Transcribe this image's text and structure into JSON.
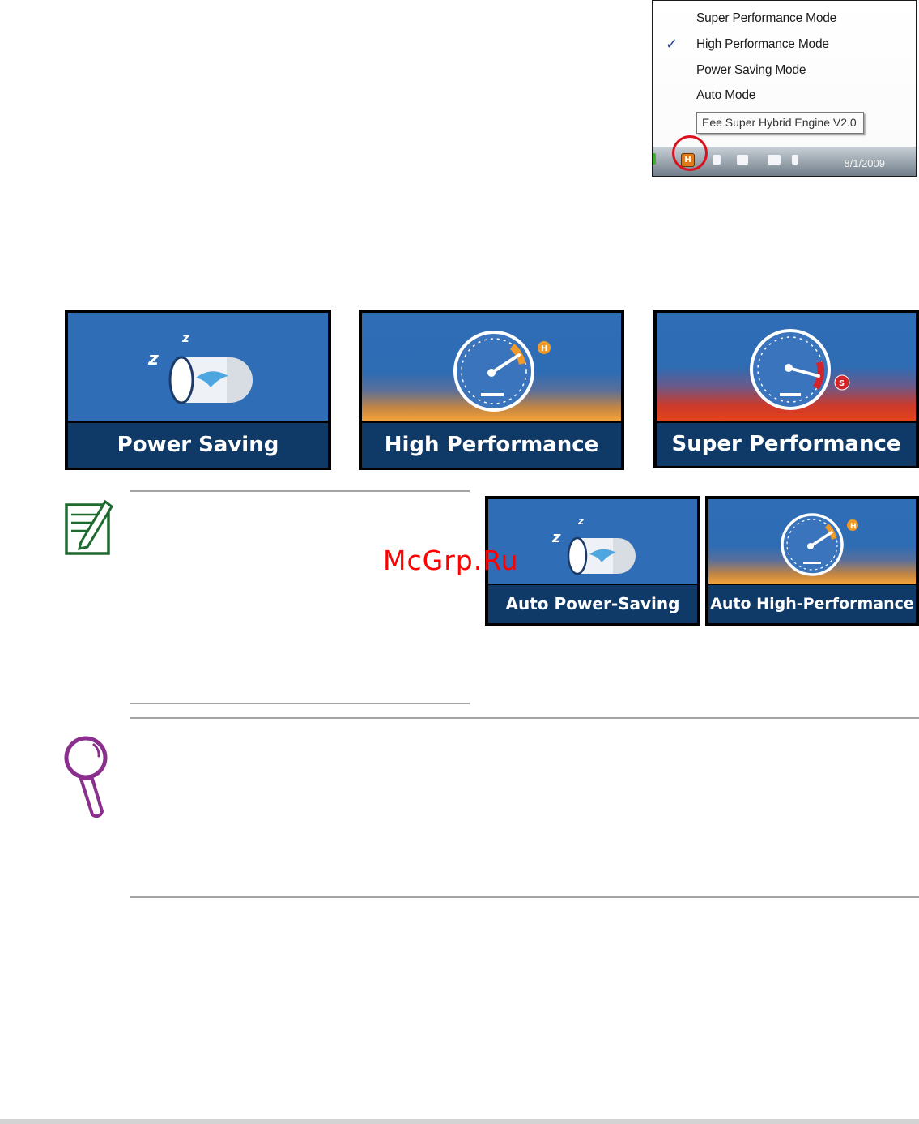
{
  "tray": {
    "menu_items": [
      {
        "label": "Super Performance Mode",
        "checked": false
      },
      {
        "label": "High Performance Mode",
        "checked": true
      },
      {
        "label": "Power Saving Mode",
        "checked": false
      },
      {
        "label": "Auto Mode",
        "checked": false
      }
    ],
    "check_mark": "✓",
    "tooltip": "Eee Super Hybrid Engine V2.0",
    "app_icon_letter": "H",
    "date": "8/1/2009",
    "highlight_color": "#d9121c"
  },
  "modes": {
    "power_saving": {
      "label": "Power Saving",
      "icon": "battery-sleep-icon"
    },
    "high_performance": {
      "label": "High Performance",
      "icon": "gauge-icon",
      "badge": "H",
      "badge_color": "#f29a28"
    },
    "super_performance": {
      "label": "Super Performance",
      "icon": "gauge-icon",
      "badge": "S",
      "badge_color": "#d4232a"
    },
    "auto_power_saving": {
      "label": "Auto Power-Saving",
      "icon": "battery-sleep-icon"
    },
    "auto_high_performance": {
      "label": "Auto High-Performance",
      "icon": "gauge-icon",
      "badge": "H",
      "badge_color": "#f29a28"
    }
  },
  "note": {
    "icon": "note-pencil-icon",
    "color": "#1f6a2f"
  },
  "hint": {
    "icon": "magnifier-icon",
    "color": "#8a2f8d"
  },
  "watermark": "McGrp.Ru"
}
